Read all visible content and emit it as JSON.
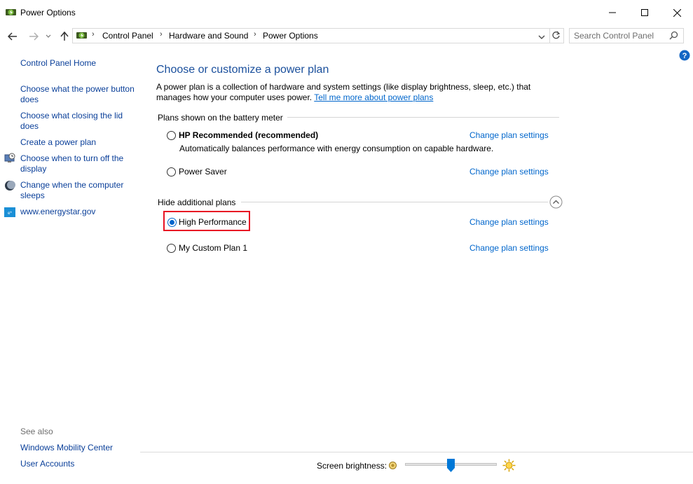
{
  "window": {
    "title": "Power Options"
  },
  "address": {
    "crumbs": [
      "Control Panel",
      "Hardware and Sound",
      "Power Options"
    ],
    "search_placeholder": "Search Control Panel"
  },
  "sidebar": {
    "home": "Control Panel Home",
    "items": [
      "Choose what the power button does",
      "Choose what closing the lid does",
      "Create a power plan",
      "Choose when to turn off the display",
      "Change when the computer sleeps",
      "www.energystar.gov"
    ],
    "see_also": "See also",
    "see_also_items": [
      "Windows Mobility Center",
      "User Accounts"
    ]
  },
  "main": {
    "heading": "Choose or customize a power plan",
    "description": "A power plan is a collection of hardware and system settings (like display brightness, sleep, etc.) that manages how your computer uses power.",
    "tell_me_link": "Tell me more about power plans",
    "battery_section": "Plans shown on the battery meter",
    "additional_section": "Hide additional plans",
    "change_link": "Change plan settings",
    "plans": [
      {
        "name": "HP Recommended (recommended)",
        "desc": "Automatically balances performance with energy consumption on capable hardware.",
        "selected": false
      },
      {
        "name": "Power Saver",
        "selected": false
      },
      {
        "name": "High Performance",
        "selected": true
      },
      {
        "name": "My Custom Plan 1",
        "selected": false
      }
    ]
  },
  "footer": {
    "brightness_label": "Screen brightness:",
    "brightness_value_fraction": 0.5
  },
  "colors": {
    "link": "#0066cc",
    "heading": "#1a4f9c",
    "highlight_border": "#e81123"
  },
  "icons": [
    "power-options-icon",
    "back-arrow-icon",
    "forward-arrow-icon",
    "recent-dropdown-icon",
    "up-arrow-icon",
    "refresh-icon",
    "search-icon",
    "help-icon",
    "minimize-icon",
    "maximize-icon",
    "close-icon",
    "clock-monitor-icon",
    "moon-icon",
    "energystar-icon",
    "collapse-chevron-icon",
    "dim-sun-icon",
    "bright-sun-icon"
  ]
}
